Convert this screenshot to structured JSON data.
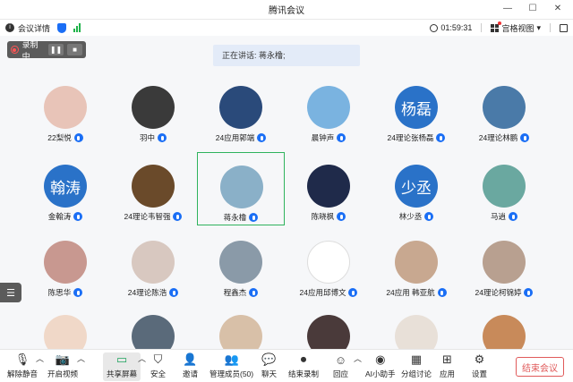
{
  "window": {
    "title": "腾讯会议",
    "minimize": "—",
    "maximize": "☐",
    "close": "✕"
  },
  "infobar": {
    "meeting_details": "会议详情",
    "timer": "01:59:31",
    "gallery_view": "宫格视图"
  },
  "recording": {
    "label": "录制中",
    "pause": "❚❚",
    "stop": "■"
  },
  "speaking": "正在讲话: 蒋永橹;",
  "participants": [
    {
      "name": "22梨悦",
      "color": "#e8c4b8"
    },
    {
      "name": "羽中",
      "color": "#3a3a3a"
    },
    {
      "name": "24应用郭端",
      "color": "#2a4a7a"
    },
    {
      "name": "晨钟声",
      "color": "#7ab3e0"
    },
    {
      "name": "24理论张杨磊",
      "avatar_text": "杨磊",
      "color": "#2a72c8"
    },
    {
      "name": "24理论林鹏",
      "color": "#4a7aa8"
    },
    {
      "name": "金翰涛",
      "avatar_text": "翰涛",
      "color": "#2a72c8"
    },
    {
      "name": "24理论韦智强",
      "color": "#6a4a2a"
    },
    {
      "name": "蒋永橹",
      "color": "#8ab0c8"
    },
    {
      "name": "陈晓枫",
      "color": "#1f2a4a"
    },
    {
      "name": "林少丞",
      "avatar_text": "少丞",
      "color": "#2a72c8"
    },
    {
      "name": "马逍",
      "color": "#6aa8a0"
    },
    {
      "name": "陈思华",
      "color": "#c89890"
    },
    {
      "name": "24理论陈浩",
      "color": "#d8c8c0"
    },
    {
      "name": "程鑫杰",
      "color": "#8a9aa8"
    },
    {
      "name": "24应用邱博文",
      "color": "#ffffff"
    },
    {
      "name": "24应用 韩亚航",
      "color": "#c8a890"
    },
    {
      "name": "24理论柯锦婷",
      "color": "#b8a090"
    },
    {
      "name": "",
      "color": "#f0d8c8"
    },
    {
      "name": "",
      "color": "#5a6a7a"
    },
    {
      "name": "",
      "color": "#d8c0a8"
    },
    {
      "name": "",
      "color": "#4a3a3a"
    },
    {
      "name": "",
      "color": "#e8e0d8"
    },
    {
      "name": "",
      "color": "#c88a5a"
    }
  ],
  "toolbar": {
    "unmute": "解除静音",
    "start_video": "开启视频",
    "share_screen": "共享屏幕",
    "security": "安全",
    "invite": "邀请",
    "manage_members": "管理成员(50)",
    "chat": "聊天",
    "end_recording": "结束录制",
    "replay": "回应",
    "ai_assistant": "AI小助手",
    "breakout": "分组讨论",
    "apps": "应用",
    "settings": "设置",
    "end_meeting": "结束会议"
  }
}
